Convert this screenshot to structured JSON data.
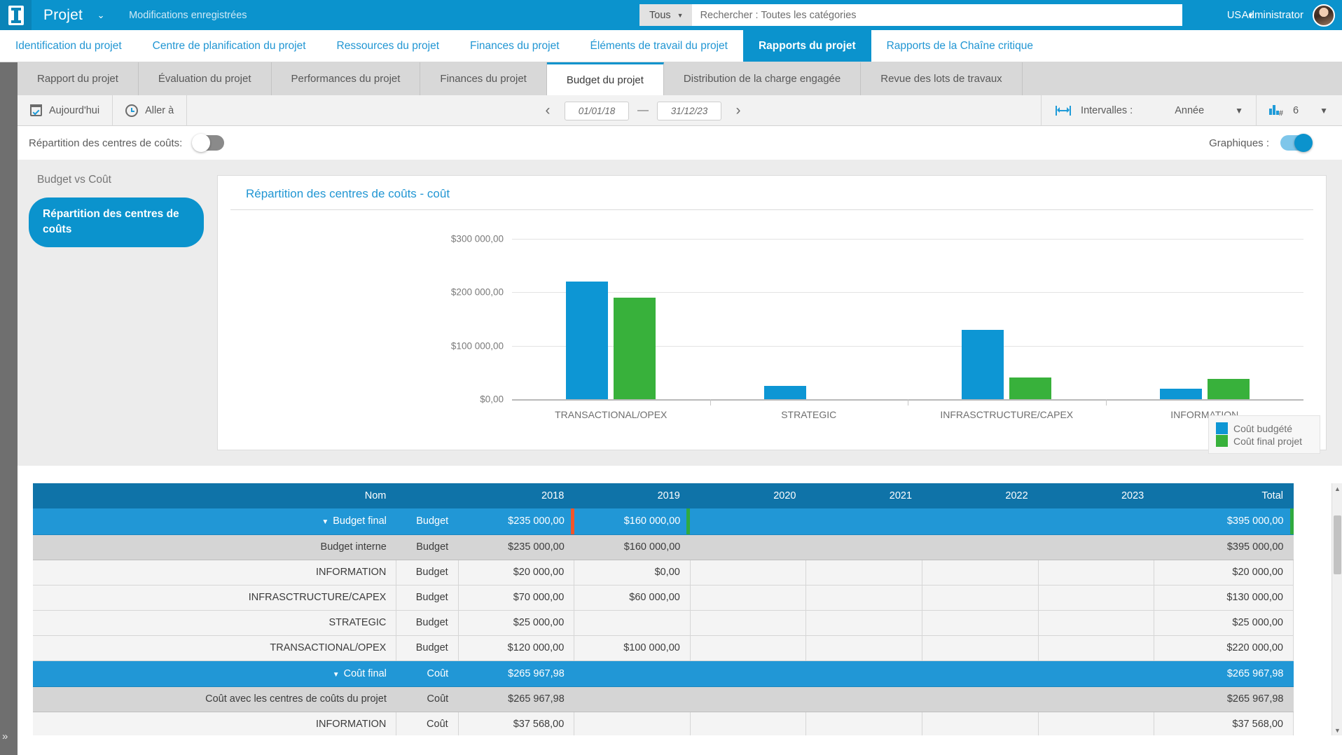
{
  "header": {
    "logo_icon": "app-logo-icon",
    "app_title": "Projet",
    "title_caret": "⌄",
    "saved_message": "Modifications enregistrées",
    "search": {
      "scope_label": "Tous",
      "scope_caret": "▼",
      "placeholder": "Rechercher : Toutes les catégories",
      "value": ""
    },
    "locale": "US",
    "locale_caret": "▼",
    "user_name": "Administrator",
    "avatar_icon": "user-avatar"
  },
  "main_nav": [
    {
      "label": "Identification du projet",
      "active": false
    },
    {
      "label": "Centre de planification du projet",
      "active": false
    },
    {
      "label": "Ressources du projet",
      "active": false
    },
    {
      "label": "Finances du projet",
      "active": false
    },
    {
      "label": "Éléments de travail du projet",
      "active": false
    },
    {
      "label": "Rapports du projet",
      "active": true
    },
    {
      "label": "Rapports de la Chaîne critique",
      "active": false
    }
  ],
  "sub_nav": [
    {
      "label": "Rapport du projet",
      "active": false
    },
    {
      "label": "Évaluation du projet",
      "active": false
    },
    {
      "label": "Performances du projet",
      "active": false
    },
    {
      "label": "Finances du projet",
      "active": false
    },
    {
      "label": "Budget du projet",
      "active": true
    },
    {
      "label": "Distribution de la charge engagée",
      "active": false
    },
    {
      "label": "Revue des lots de travaux",
      "active": false
    }
  ],
  "toolbar": {
    "today_label": "Aujourd'hui",
    "today_icon": "calendar-icon",
    "goto_label": "Aller à",
    "goto_icon": "clock-icon",
    "prev_arrow": "‹",
    "next_arrow": "›",
    "date_from": "01/01/18",
    "date_to": "31/12/23",
    "range_dash": "—",
    "intervals_label": "Intervalles :",
    "intervals_icon": "span-arrows-icon",
    "intervals_value": "Année",
    "intervals_caret": "▼",
    "count_icon": "bar-count-icon",
    "count_value": "6",
    "count_caret": "▼"
  },
  "toggles": {
    "cost_centers_label": "Répartition des centres de coûts:",
    "cost_centers_state": "off",
    "charts_label": "Graphiques :",
    "charts_state": "on"
  },
  "left_panel": {
    "heading": "Budget vs Coût",
    "active_item": "Répartition des centres de coûts"
  },
  "chart_data": {
    "type": "bar",
    "title": "Répartition des centres de coûts - coût",
    "categories": [
      "TRANSACTIONAL/OPEX",
      "STRATEGIC",
      "INFRASCTRUCTURE/CAPEX",
      "INFORMATION"
    ],
    "series": [
      {
        "name": "Coût budgété",
        "color": "#0d96d4",
        "values": [
          220000,
          25000,
          130000,
          20000
        ]
      },
      {
        "name": "Coût final projet",
        "color": "#38b13b",
        "values": [
          190000,
          0,
          40000,
          37568
        ]
      }
    ],
    "ylabel": "",
    "xlabel": "",
    "ylim": [
      0,
      330000
    ],
    "yticks": [
      0,
      100000,
      200000,
      300000
    ],
    "ytick_labels": [
      "$0,00",
      "$100 000,00",
      "$200 000,00",
      "$300 000,00"
    ],
    "grid": true,
    "legend_position": "right"
  },
  "table": {
    "columns": [
      "Nom",
      "",
      "2018",
      "2019",
      "2020",
      "2021",
      "2022",
      "2023",
      "Total"
    ],
    "rows": [
      {
        "style": "summary",
        "expander": "▼",
        "name": "Budget final",
        "type": "Budget",
        "cells": [
          "$235 000,00",
          "$160 000,00",
          "",
          "",
          "",
          "",
          "$395 000,00"
        ],
        "markers": {
          "2018": "#f1562a",
          "2019": "#2faa3f",
          "Total": "#2faa3f"
        }
      },
      {
        "style": "subtotal",
        "expander": "",
        "name": "Budget interne",
        "type": "Budget",
        "cells": [
          "$235 000,00",
          "$160 000,00",
          "",
          "",
          "",
          "",
          "$395 000,00"
        ]
      },
      {
        "style": "normal",
        "expander": "",
        "name": "INFORMATION",
        "type": "Budget",
        "cells": [
          "$20 000,00",
          "$0,00",
          "",
          "",
          "",
          "",
          "$20 000,00"
        ]
      },
      {
        "style": "normal",
        "expander": "",
        "name": "INFRASCTRUCTURE/CAPEX",
        "type": "Budget",
        "cells": [
          "$70 000,00",
          "$60 000,00",
          "",
          "",
          "",
          "",
          "$130 000,00"
        ]
      },
      {
        "style": "normal",
        "expander": "",
        "name": "STRATEGIC",
        "type": "Budget",
        "cells": [
          "$25 000,00",
          "",
          "",
          "",
          "",
          "",
          "$25 000,00"
        ]
      },
      {
        "style": "normal",
        "expander": "",
        "name": "TRANSACTIONAL/OPEX",
        "type": "Budget",
        "cells": [
          "$120 000,00",
          "$100 000,00",
          "",
          "",
          "",
          "",
          "$220 000,00"
        ]
      },
      {
        "style": "summary",
        "expander": "▼",
        "name": "Coût final",
        "type": "Coût",
        "cells": [
          "$265 967,98",
          "",
          "",
          "",
          "",
          "",
          "$265 967,98"
        ]
      },
      {
        "style": "subtotal",
        "expander": "",
        "name": "Coût avec les centres de coûts du projet",
        "type": "Coût",
        "cells": [
          "$265 967,98",
          "",
          "",
          "",
          "",
          "",
          "$265 967,98"
        ]
      },
      {
        "style": "normal",
        "expander": "",
        "name": "INFORMATION",
        "type": "Coût",
        "cells": [
          "$37 568,00",
          "",
          "",
          "",
          "",
          "",
          "$37 568,00"
        ]
      }
    ]
  },
  "rail": {
    "expand_icon": "»"
  },
  "colors": {
    "brand_blue": "#0b93cd",
    "header_blue": "#0f73a8",
    "row_blue": "#2197d6",
    "series_blue": "#0d96d4",
    "series_green": "#38b13b",
    "marker_red": "#f1562a",
    "marker_green": "#2faa3f"
  }
}
